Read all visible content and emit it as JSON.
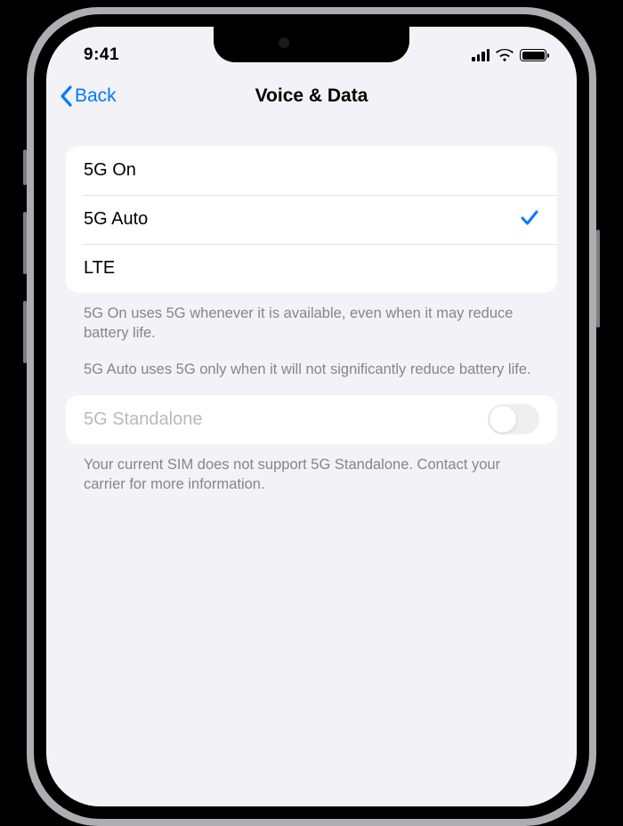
{
  "status": {
    "time": "9:41"
  },
  "nav": {
    "back_label": "Back",
    "title": "Voice & Data"
  },
  "options": [
    {
      "label": "5G On",
      "selected": false
    },
    {
      "label": "5G Auto",
      "selected": true
    },
    {
      "label": "LTE",
      "selected": false
    }
  ],
  "footer": {
    "p1": "5G On uses 5G whenever it is available, even when it may reduce battery life.",
    "p2": "5G Auto uses 5G only when it will not significantly reduce battery life."
  },
  "standalone": {
    "label": "5G Standalone",
    "enabled": false,
    "footer": "Your current SIM does not support 5G Standalone. Contact your carrier for more information."
  }
}
